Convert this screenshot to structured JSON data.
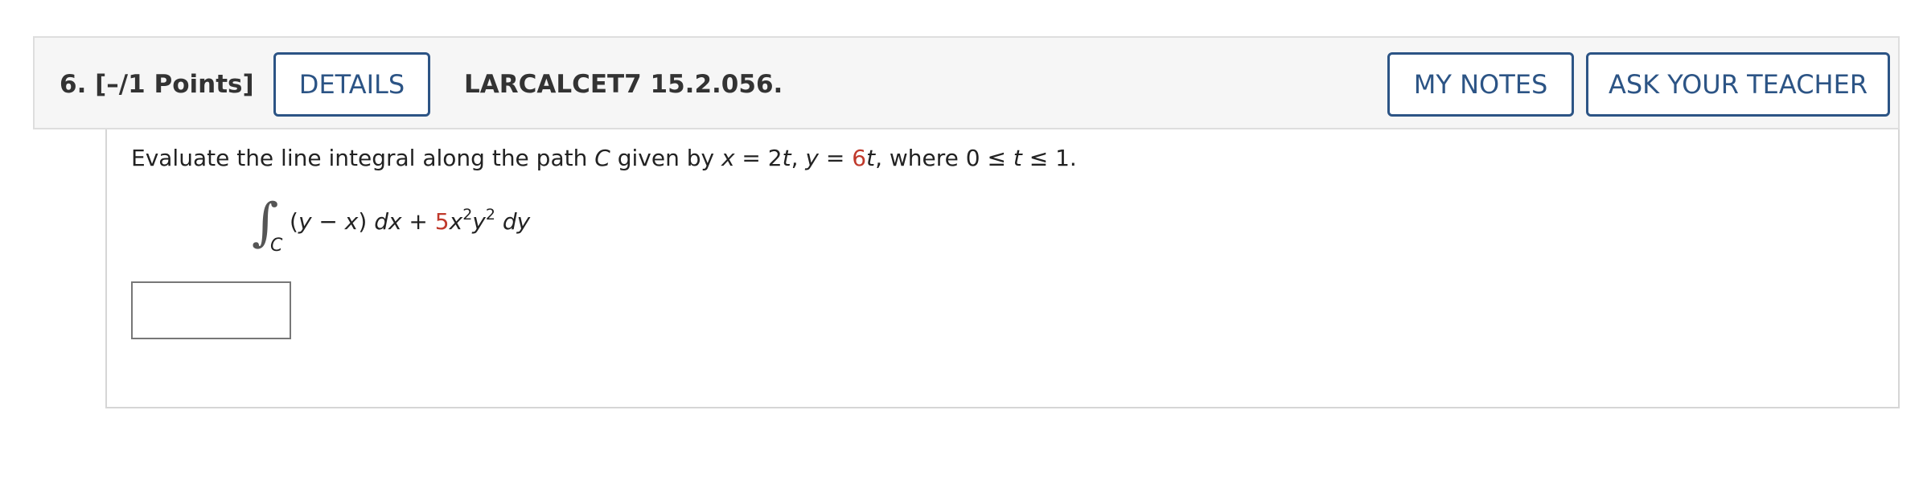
{
  "question": {
    "number_points": "6.  [–/1 Points]",
    "reference": "LARCALCET7 15.2.056."
  },
  "buttons": {
    "details": "DETAILS",
    "my_notes": "MY NOTES",
    "ask_teacher": "ASK YOUR TEACHER"
  },
  "prompt": {
    "p1": "Evaluate the line integral along the path ",
    "path_var": "C",
    "p2": " given by ",
    "x": "x",
    "p3": " = 2",
    "t1": "t",
    "p4": ", ",
    "y": "y",
    "p5": " = ",
    "coef": "6",
    "t2": "t",
    "p6": ", where 0 ≤ ",
    "t3": "t",
    "p7": " ≤ 1."
  },
  "integral": {
    "symbol": "∫",
    "subscript": "C",
    "open": "(",
    "y": "y",
    "minus": " − ",
    "x": "x",
    "close": ") ",
    "dx": "dx",
    "plus": " + ",
    "coef": "5",
    "x2": "x",
    "exp1": "2",
    "y2": "y",
    "exp2": "2",
    "dy": " dy"
  },
  "answer": {
    "value": "",
    "placeholder": ""
  },
  "colors": {
    "accent": "#2c5485",
    "random_value": "#c0392b",
    "header_bg": "#f6f6f6"
  }
}
